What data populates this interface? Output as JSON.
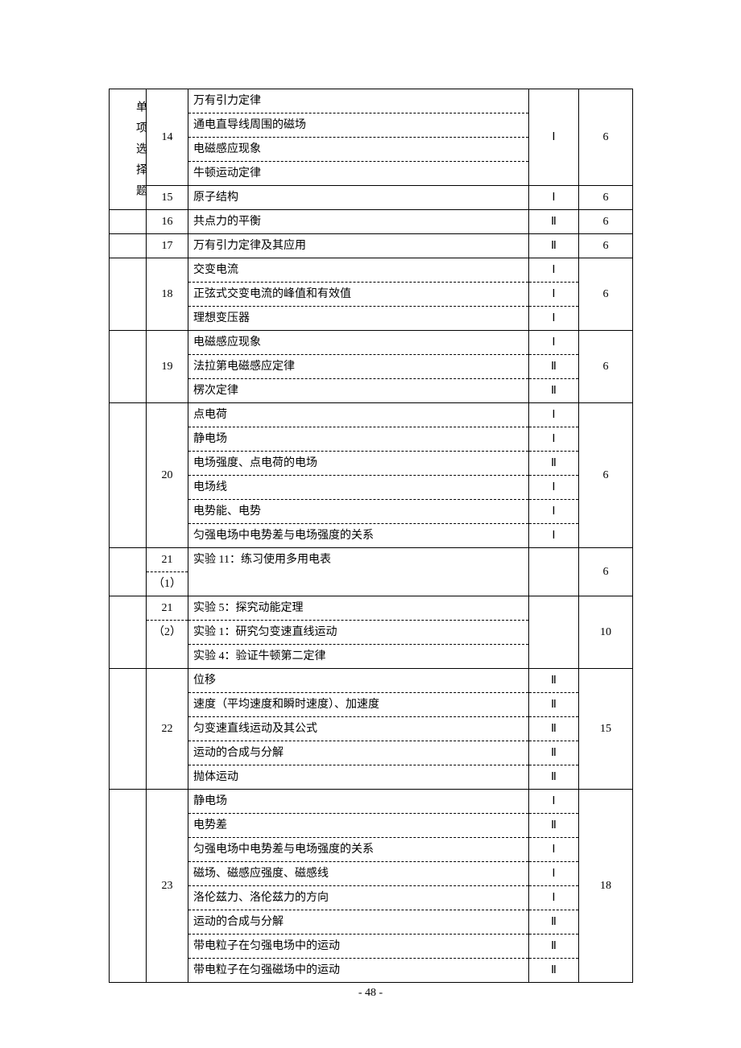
{
  "page_number": "- 48 -",
  "col1_header": "单项选择题",
  "rows": [
    {
      "n": "14",
      "topics": [
        "万有引力定律",
        "通电直导线周围的磁场",
        "电磁感应现象",
        "牛顿运动定律"
      ],
      "levels": [
        "",
        "",
        "Ⅰ",
        ""
      ],
      "score": "6",
      "leveltype": "merged"
    },
    {
      "n": "15",
      "topics": [
        "原子结构"
      ],
      "levels": [
        "Ⅰ"
      ],
      "score": "6"
    },
    {
      "n": "16",
      "topics": [
        "共点力的平衡"
      ],
      "levels": [
        "Ⅱ"
      ],
      "score": "6"
    },
    {
      "n": "17",
      "topics": [
        "万有引力定律及其应用"
      ],
      "levels": [
        "Ⅱ"
      ],
      "score": "6"
    },
    {
      "n": "18",
      "topics": [
        "交变电流",
        "正弦式交变电流的峰值和有效值",
        "理想变压器"
      ],
      "levels": [
        "Ⅰ",
        "Ⅰ",
        "Ⅰ"
      ],
      "score": "6"
    },
    {
      "n": "19",
      "topics": [
        "电磁感应现象",
        "法拉第电磁感应定律",
        "楞次定律"
      ],
      "levels": [
        "Ⅰ",
        "Ⅱ",
        "Ⅱ"
      ],
      "score": "6"
    },
    {
      "n": "20",
      "topics": [
        "点电荷",
        "静电场",
        "电场强度、点电荷的电场",
        "电场线",
        "电势能、电势",
        "匀强电场中电势差与电场强度的关系"
      ],
      "levels": [
        "Ⅰ",
        "Ⅰ",
        "Ⅱ",
        "Ⅰ",
        "Ⅰ",
        "Ⅰ"
      ],
      "score": "6"
    },
    {
      "n": "21",
      "sub": "（1）",
      "topics": [
        "实验 11：练习使用多用电表"
      ],
      "levels": [
        ""
      ],
      "score": "6",
      "two_line_num": true
    },
    {
      "n": "21",
      "sub": "（2）",
      "topics": [
        "实验 5：探究动能定理",
        "实验 1：研究匀变速直线运动",
        "实验 4：验证牛顿第二定律"
      ],
      "levels": [
        "",
        "",
        ""
      ],
      "score": "10",
      "two_line_num": true,
      "leveltype": "merged"
    },
    {
      "n": "22",
      "topics": [
        "位移",
        "速度（平均速度和瞬时速度）、加速度",
        "匀变速直线运动及其公式",
        "运动的合成与分解",
        "抛体运动"
      ],
      "levels": [
        "Ⅱ",
        "Ⅱ",
        "Ⅱ",
        "Ⅱ",
        "Ⅱ"
      ],
      "score": "15"
    },
    {
      "n": "23",
      "topics": [
        "静电场",
        "电势差",
        "匀强电场中电势差与电场强度的关系",
        "磁场、磁感应强度、磁感线",
        "洛伦兹力、洛伦兹力的方向",
        "运动的合成与分解",
        "带电粒子在匀强电场中的运动",
        "带电粒子在匀强磁场中的运动"
      ],
      "levels": [
        "Ⅰ",
        "Ⅱ",
        "Ⅰ",
        "Ⅰ",
        "Ⅰ",
        "Ⅱ",
        "Ⅱ",
        "Ⅱ"
      ],
      "score": "18"
    }
  ]
}
